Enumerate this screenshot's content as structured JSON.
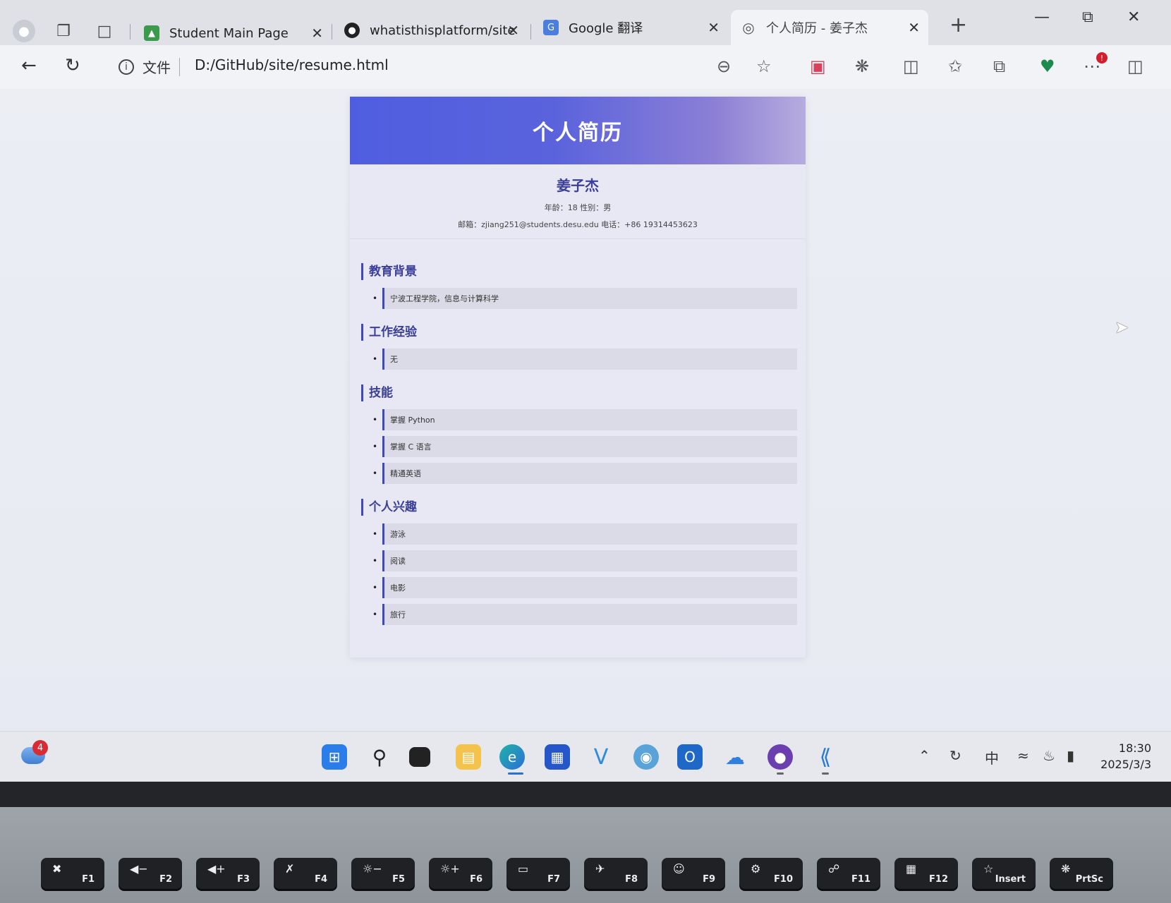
{
  "browser": {
    "tabs": [
      {
        "label": "Student Main Page",
        "active": false
      },
      {
        "label": "whatisthisplatform/site",
        "active": false
      },
      {
        "label": "Google 翻译",
        "active": false
      },
      {
        "label": "个人简历 - 姜子杰",
        "active": true
      }
    ],
    "address": {
      "scheme_label": "文件",
      "url": "D:/GitHub/site/resume.html"
    }
  },
  "resume": {
    "header_title": "个人简历",
    "name": "姜子杰",
    "basic_line": "年龄：18 性别：男",
    "contact_line": "邮箱：zjiang251@students.desu.edu 电话：+86 19314453623",
    "sections": [
      {
        "title": "教育背景",
        "items": [
          "宁波工程学院，信息与计算科学"
        ]
      },
      {
        "title": "工作经验",
        "items": [
          "无"
        ]
      },
      {
        "title": "技能",
        "items": [
          "掌握 Python",
          "掌握 C 语言",
          "精通英语"
        ]
      },
      {
        "title": "个人兴趣",
        "items": [
          "游泳",
          "阅读",
          "电影",
          "旅行"
        ]
      }
    ]
  },
  "taskbar": {
    "weather_badge": "4",
    "tray_ime": "中",
    "time": "18:30",
    "date": "2025/3/3"
  },
  "keyboard": {
    "keys": [
      "F1",
      "F2",
      "F3",
      "F4",
      "F5",
      "F6",
      "F7",
      "F8",
      "F9",
      "F10",
      "F11",
      "F12",
      "Insert",
      "PrtSc"
    ]
  },
  "colors": {
    "accent": "#3f49b8",
    "header_start": "#4f5ee0",
    "header_end": "#b7acdf"
  }
}
